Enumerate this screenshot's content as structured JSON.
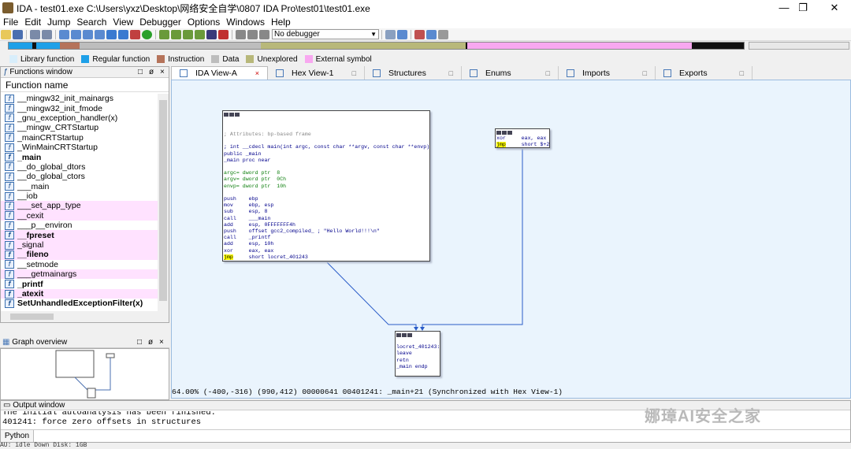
{
  "window": {
    "title": "IDA - test01.exe C:\\Users\\yxz\\Desktop\\网络安全自学\\0807 IDA Pro\\test01\\test01.exe",
    "minimize": "—",
    "maximize": "❐",
    "close": "✕"
  },
  "menu": [
    "File",
    "Edit",
    "Jump",
    "Search",
    "View",
    "Debugger",
    "Options",
    "Windows",
    "Help"
  ],
  "toolbar": {
    "debugger_value": "No debugger"
  },
  "legend": [
    {
      "label": "Library function",
      "color": "#d8eefb"
    },
    {
      "label": "Regular function",
      "color": "#1ea0e8"
    },
    {
      "label": "Instruction",
      "color": "#b5735a"
    },
    {
      "label": "Data",
      "color": "#bdbdbd"
    },
    {
      "label": "Unexplored",
      "color": "#b8b87a"
    },
    {
      "label": "External symbol",
      "color": "#f8a8f0"
    }
  ],
  "functions_window": {
    "title": "Functions window",
    "controls": [
      "□",
      "ø",
      "×"
    ],
    "column": "Function name",
    "items": [
      {
        "name": "__mingw32_init_mainargs",
        "pink": false,
        "bold": false
      },
      {
        "name": "__mingw32_init_fmode",
        "pink": false,
        "bold": false
      },
      {
        "name": "_gnu_exception_handler(x)",
        "pink": false,
        "bold": false
      },
      {
        "name": "__mingw_CRTStartup",
        "pink": false,
        "bold": false
      },
      {
        "name": "_mainCRTStartup",
        "pink": false,
        "bold": false
      },
      {
        "name": "_WinMainCRTStartup",
        "pink": false,
        "bold": false
      },
      {
        "name": "_main",
        "pink": false,
        "bold": true
      },
      {
        "name": "__do_global_dtors",
        "pink": false,
        "bold": false
      },
      {
        "name": "__do_global_ctors",
        "pink": false,
        "bold": false
      },
      {
        "name": "___main",
        "pink": false,
        "bold": false
      },
      {
        "name": "__iob",
        "pink": false,
        "bold": false
      },
      {
        "name": "___set_app_type",
        "pink": true,
        "bold": false
      },
      {
        "name": "__cexit",
        "pink": true,
        "bold": false
      },
      {
        "name": "___p__environ",
        "pink": false,
        "bold": false
      },
      {
        "name": "__fpreset",
        "pink": true,
        "bold": true
      },
      {
        "name": "_signal",
        "pink": true,
        "bold": false
      },
      {
        "name": "__fileno",
        "pink": true,
        "bold": true
      },
      {
        "name": "__setmode",
        "pink": false,
        "bold": false
      },
      {
        "name": "___getmainargs",
        "pink": true,
        "bold": false
      },
      {
        "name": "_printf",
        "pink": false,
        "bold": true
      },
      {
        "name": "_atexit",
        "pink": true,
        "bold": true
      },
      {
        "name": "SetUnhandledExceptionFilter(x)",
        "pink": false,
        "bold": true
      }
    ]
  },
  "graph_overview": {
    "title": "Graph overview",
    "controls": [
      "□",
      "ø",
      "×"
    ]
  },
  "tabs": [
    {
      "label": "IDA View-A",
      "close": "×"
    },
    {
      "label": "Hex View-1",
      "close": "□"
    },
    {
      "label": "Structures",
      "close": "□"
    },
    {
      "label": "Enums",
      "close": "□"
    },
    {
      "label": "Imports",
      "close": "□"
    },
    {
      "label": "Exports",
      "close": "□"
    }
  ],
  "graph": {
    "main_block": {
      "header": "; Attributes: bp-based frame",
      "lines": [
        {
          "t": "",
          "c": ""
        },
        {
          "t": "; int __cdecl main(int argc, const char **argv, const char **envp)",
          "c": "nav"
        },
        {
          "t": "public _main",
          "c": "nav"
        },
        {
          "t": "_main proc near",
          "c": "nav"
        },
        {
          "t": "",
          "c": ""
        },
        {
          "t": "argc= dword ptr  8",
          "c": "grn"
        },
        {
          "t": "argv= dword ptr  0Ch",
          "c": "grn"
        },
        {
          "t": "envp= dword ptr  10h",
          "c": "grn"
        },
        {
          "t": "",
          "c": ""
        },
        {
          "t": "push    ebp",
          "c": "nav"
        },
        {
          "t": "mov     ebp, esp",
          "c": "nav"
        },
        {
          "t": "sub     esp, 8",
          "c": "nav"
        },
        {
          "t": "call    ___main",
          "c": "nav"
        },
        {
          "t": "add     esp, 0FFFFFFF4h",
          "c": "nav"
        },
        {
          "t": "push    offset gcc2_compiled_ ; \"Hello World!!!\\n\"",
          "c": "nav"
        },
        {
          "t": "call    _printf",
          "c": "nav"
        },
        {
          "t": "add     esp, 10h",
          "c": "nav"
        },
        {
          "t": "xor     eax, eax",
          "c": "nav"
        },
        {
          "t": "jmp     short locret_401243",
          "c": "jmp"
        }
      ]
    },
    "small_block": [
      {
        "t": "xor     eax, eax",
        "c": "nav"
      },
      {
        "t": "jmp     short $+2",
        "c": "jmp"
      }
    ],
    "ret_block": [
      {
        "t": "",
        "c": ""
      },
      {
        "t": "locret_401243:",
        "c": "nav"
      },
      {
        "t": "leave",
        "c": "nav"
      },
      {
        "t": "retn",
        "c": "nav"
      },
      {
        "t": "_main endp",
        "c": "nav"
      }
    ],
    "status": "64.00% (-400,-316) (990,412) 00000641 00401241: _main+21 (Synchronized with Hex View-1)"
  },
  "output_window": {
    "title": "Output window",
    "lines": [
      "The initial autoanalysis has been finished.",
      "401241: force zero offsets in structures"
    ],
    "python_button": "Python"
  },
  "status_bar": "AU:  idle   Down    Disk: 1GB",
  "watermark": "娜璋AI安全之家"
}
